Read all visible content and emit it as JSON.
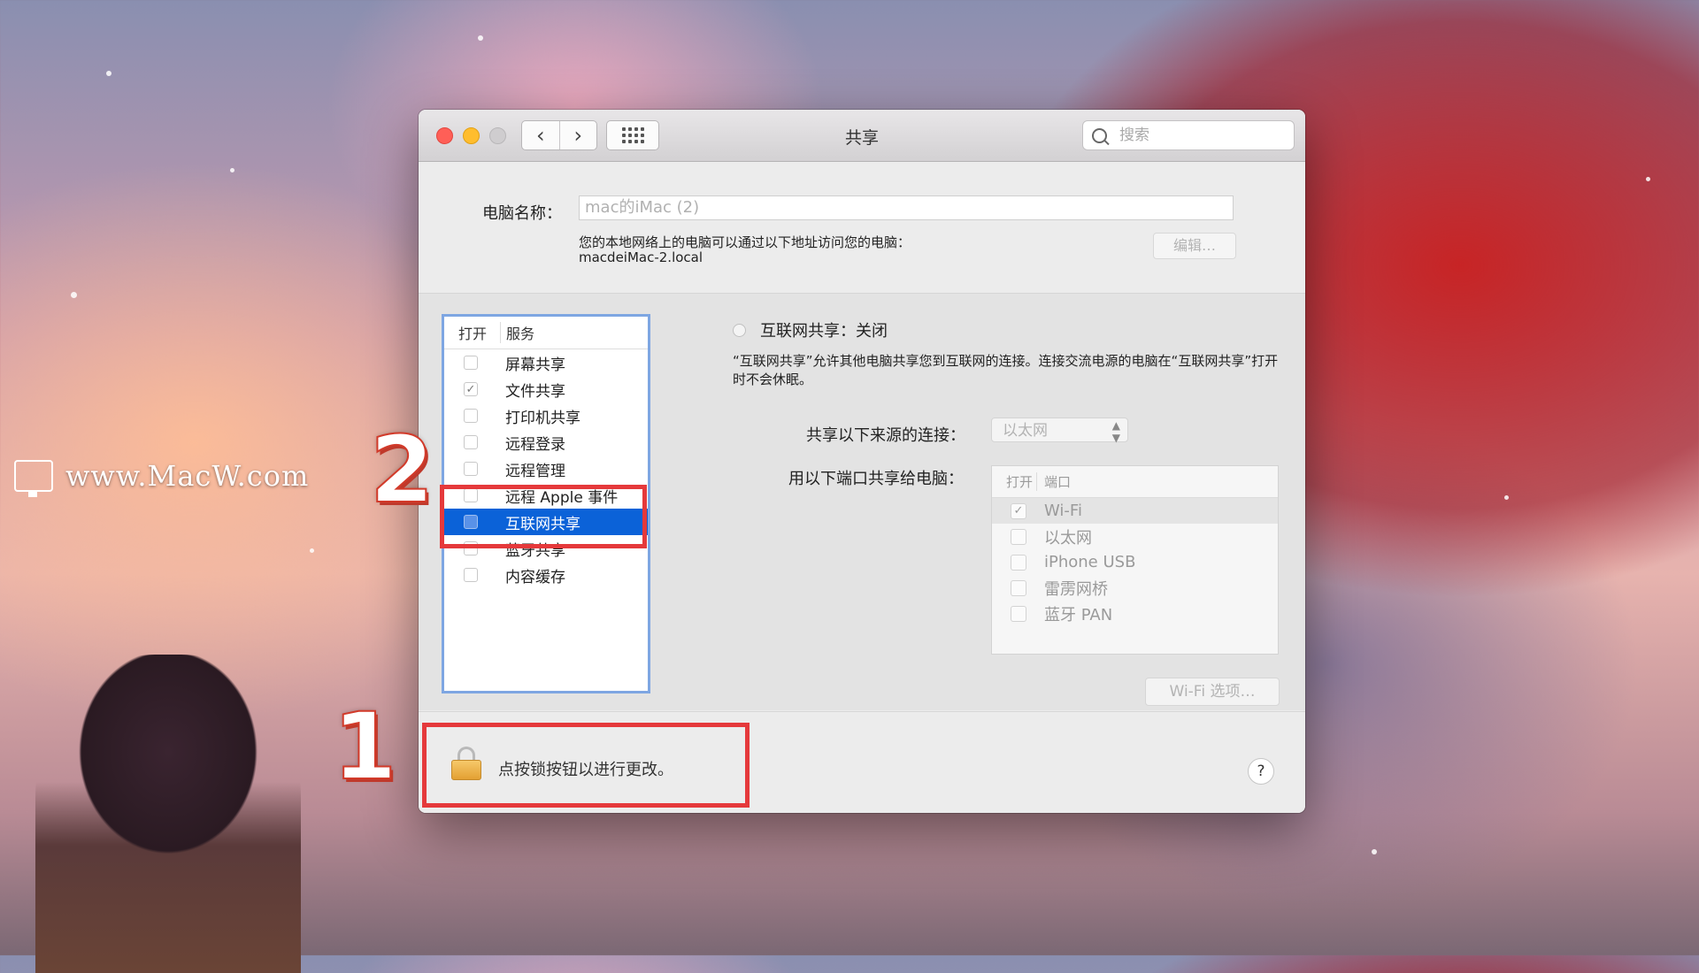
{
  "watermark": {
    "text": "www.MacW.com"
  },
  "annotations": [
    {
      "number": "1",
      "color": "#e5393b"
    },
    {
      "number": "2",
      "color": "#e5393b"
    }
  ],
  "window": {
    "title": "共享",
    "nav": {
      "back_icon": "chevron-left-icon",
      "forward_icon": "chevron-right-icon",
      "grid_icon": "show-all-grid-icon"
    },
    "search": {
      "placeholder": "搜索"
    }
  },
  "computer_name": {
    "label": "电脑名称：",
    "value": "mac的iMac (2)",
    "description": "您的本地网络上的电脑可以通过以下地址访问您的电脑：",
    "hostname": "macdeiMac-2.local",
    "edit_button": "编辑…"
  },
  "services": {
    "header_on": "打开",
    "header_name": "服务",
    "items": [
      {
        "label": "屏幕共享",
        "checked": false,
        "selected": false
      },
      {
        "label": "文件共享",
        "checked": true,
        "selected": false
      },
      {
        "label": "打印机共享",
        "checked": false,
        "selected": false
      },
      {
        "label": "远程登录",
        "checked": false,
        "selected": false
      },
      {
        "label": "远程管理",
        "checked": false,
        "selected": false
      },
      {
        "label": "远程 Apple 事件",
        "checked": false,
        "selected": false
      },
      {
        "label": "互联网共享",
        "checked": false,
        "selected": true
      },
      {
        "label": "蓝牙共享",
        "checked": false,
        "selected": false
      },
      {
        "label": "内容缓存",
        "checked": false,
        "selected": false
      }
    ]
  },
  "detail": {
    "status_title": "互联网共享：关闭",
    "description": "“互联网共享”允许其他电脑共享您到互联网的连接。连接交流电源的电脑在“互联网共享”打开时不会休眠。",
    "source_label": "共享以下来源的连接：",
    "source_value": "以太网",
    "ports_label": "用以下端口共享给电脑：",
    "ports_header_on": "打开",
    "ports_header_name": "端口",
    "ports": [
      {
        "label": "Wi-Fi",
        "checked": true
      },
      {
        "label": "以太网",
        "checked": false
      },
      {
        "label": "iPhone USB",
        "checked": false
      },
      {
        "label": "雷雳网桥",
        "checked": false
      },
      {
        "label": "蓝牙 PAN",
        "checked": false
      }
    ],
    "wifi_options_button": "Wi-Fi 选项…"
  },
  "footer": {
    "lock_text": "点按锁按钮以进行更改。",
    "help_label": "?"
  },
  "colors": {
    "selection_blue": "#0b62d8",
    "highlight_red": "#e5393b",
    "close": "#ff5f57",
    "minimize": "#ffbd2e"
  }
}
